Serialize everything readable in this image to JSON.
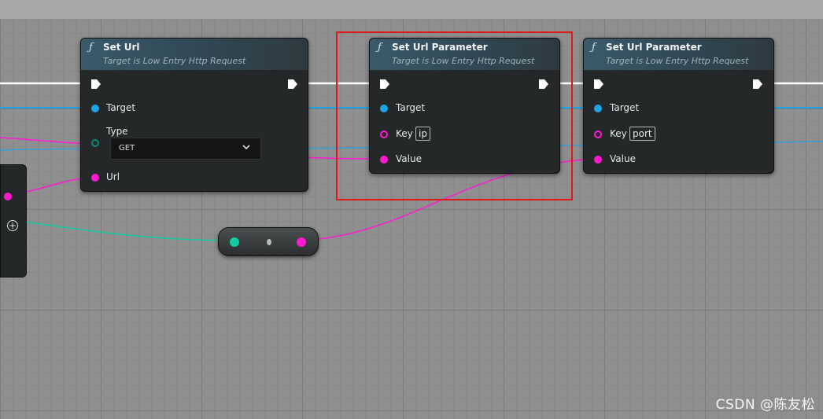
{
  "nodes": {
    "set_url": {
      "title": "Set Url",
      "subtitle": "Target is Low Entry Http Request",
      "pins": {
        "target": "Target",
        "type": "Type",
        "type_value": "GET",
        "url": "Url"
      }
    },
    "set_url_param_1": {
      "title": "Set Url Parameter",
      "subtitle": "Target is Low Entry Http Request",
      "pins": {
        "target": "Target",
        "key": "Key",
        "key_value": "ip",
        "value": "Value"
      }
    },
    "set_url_param_2": {
      "title": "Set Url Parameter",
      "subtitle": "Target is Low Entry Http Request",
      "pins": {
        "target": "Target",
        "key": "Key",
        "key_value": "port",
        "value": "Value"
      }
    }
  },
  "icons": {
    "function": "ƒ",
    "add_pin": "+"
  },
  "watermark": "CSDN @陈友松",
  "colors": {
    "exec_wire": "#ffffff",
    "object_wire": "#1ea3e6",
    "string_wire": "#ff1ad1",
    "integer_wire": "#14caa0",
    "highlight": "#e01818"
  }
}
